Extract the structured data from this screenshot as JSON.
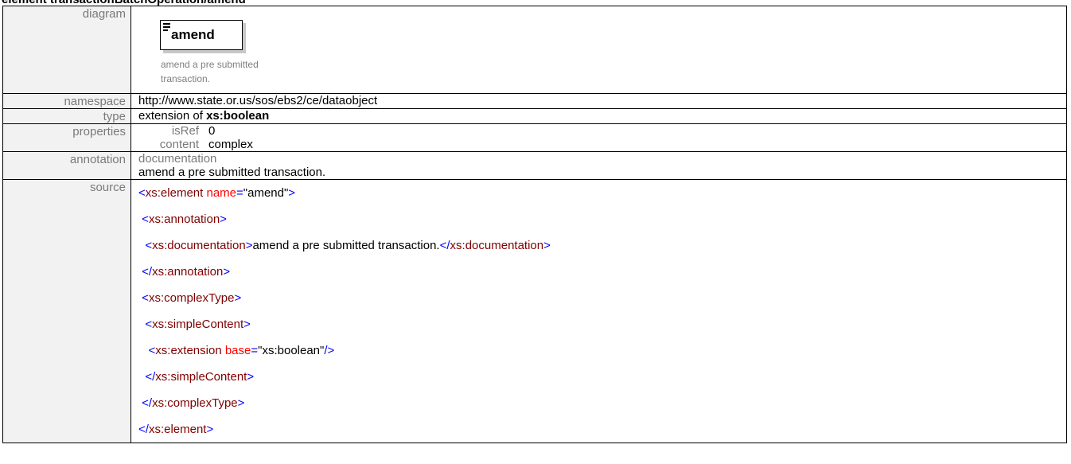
{
  "page_heading": "element transactionBatchOperation/amend",
  "rows": {
    "diagram": {
      "label": "diagram",
      "element_name": "amend",
      "doc_text": "amend a pre submitted transaction."
    },
    "namespace": {
      "label": "namespace",
      "value": "http://www.state.or.us/sos/ebs2/ce/dataobject"
    },
    "type": {
      "label": "type",
      "prefix": "extension of ",
      "base": "xs:boolean"
    },
    "properties": {
      "label": "properties",
      "items": [
        {
          "key": "isRef",
          "value": "0"
        },
        {
          "key": "content",
          "value": "complex"
        }
      ]
    },
    "annotation": {
      "label": "annotation",
      "key": "documentation",
      "text": "amend a pre submitted transaction."
    },
    "source": {
      "label": "source",
      "element_tag": "xs:element",
      "name_attr": "name",
      "name_val": "\"amend\"",
      "annotation_tag": "xs:annotation",
      "documentation_tag": "xs:documentation",
      "documentation_text": "amend a pre submitted transaction.",
      "complextype_tag": "xs:complexType",
      "simplecontent_tag": "xs:simpleContent",
      "extension_tag": "xs:extension",
      "base_attr": "base",
      "base_val": "\"xs:boolean\""
    }
  }
}
